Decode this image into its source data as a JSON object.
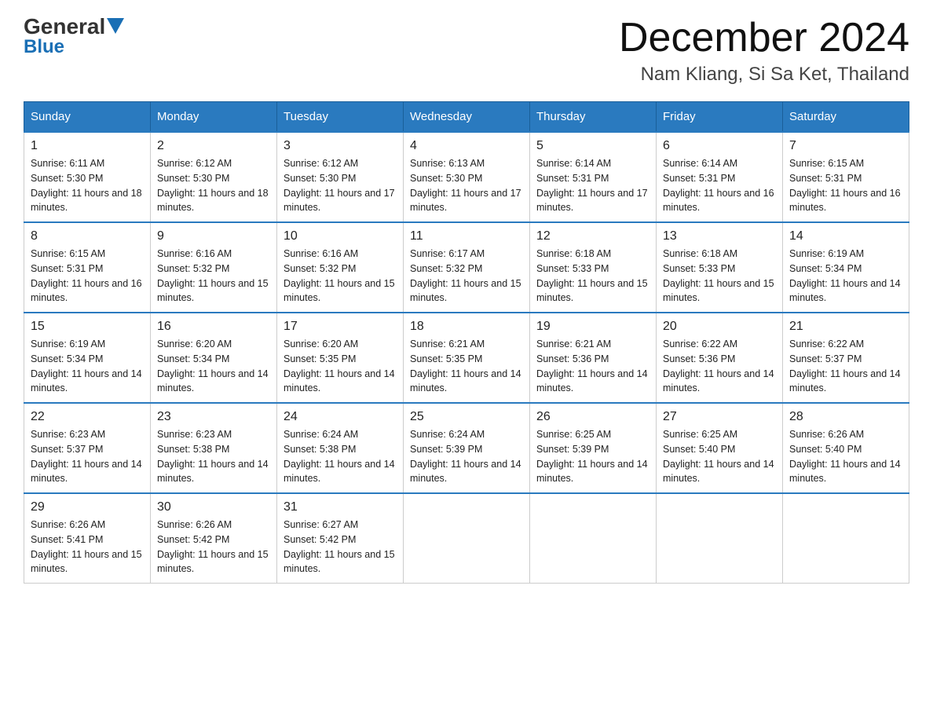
{
  "header": {
    "logo_general": "General",
    "logo_blue": "Blue",
    "month_title": "December 2024",
    "location": "Nam Kliang, Si Sa Ket, Thailand"
  },
  "weekdays": [
    "Sunday",
    "Monday",
    "Tuesday",
    "Wednesday",
    "Thursday",
    "Friday",
    "Saturday"
  ],
  "weeks": [
    [
      {
        "day": "1",
        "sunrise": "6:11 AM",
        "sunset": "5:30 PM",
        "daylight": "11 hours and 18 minutes."
      },
      {
        "day": "2",
        "sunrise": "6:12 AM",
        "sunset": "5:30 PM",
        "daylight": "11 hours and 18 minutes."
      },
      {
        "day": "3",
        "sunrise": "6:12 AM",
        "sunset": "5:30 PM",
        "daylight": "11 hours and 17 minutes."
      },
      {
        "day": "4",
        "sunrise": "6:13 AM",
        "sunset": "5:30 PM",
        "daylight": "11 hours and 17 minutes."
      },
      {
        "day": "5",
        "sunrise": "6:14 AM",
        "sunset": "5:31 PM",
        "daylight": "11 hours and 17 minutes."
      },
      {
        "day": "6",
        "sunrise": "6:14 AM",
        "sunset": "5:31 PM",
        "daylight": "11 hours and 16 minutes."
      },
      {
        "day": "7",
        "sunrise": "6:15 AM",
        "sunset": "5:31 PM",
        "daylight": "11 hours and 16 minutes."
      }
    ],
    [
      {
        "day": "8",
        "sunrise": "6:15 AM",
        "sunset": "5:31 PM",
        "daylight": "11 hours and 16 minutes."
      },
      {
        "day": "9",
        "sunrise": "6:16 AM",
        "sunset": "5:32 PM",
        "daylight": "11 hours and 15 minutes."
      },
      {
        "day": "10",
        "sunrise": "6:16 AM",
        "sunset": "5:32 PM",
        "daylight": "11 hours and 15 minutes."
      },
      {
        "day": "11",
        "sunrise": "6:17 AM",
        "sunset": "5:32 PM",
        "daylight": "11 hours and 15 minutes."
      },
      {
        "day": "12",
        "sunrise": "6:18 AM",
        "sunset": "5:33 PM",
        "daylight": "11 hours and 15 minutes."
      },
      {
        "day": "13",
        "sunrise": "6:18 AM",
        "sunset": "5:33 PM",
        "daylight": "11 hours and 15 minutes."
      },
      {
        "day": "14",
        "sunrise": "6:19 AM",
        "sunset": "5:34 PM",
        "daylight": "11 hours and 14 minutes."
      }
    ],
    [
      {
        "day": "15",
        "sunrise": "6:19 AM",
        "sunset": "5:34 PM",
        "daylight": "11 hours and 14 minutes."
      },
      {
        "day": "16",
        "sunrise": "6:20 AM",
        "sunset": "5:34 PM",
        "daylight": "11 hours and 14 minutes."
      },
      {
        "day": "17",
        "sunrise": "6:20 AM",
        "sunset": "5:35 PM",
        "daylight": "11 hours and 14 minutes."
      },
      {
        "day": "18",
        "sunrise": "6:21 AM",
        "sunset": "5:35 PM",
        "daylight": "11 hours and 14 minutes."
      },
      {
        "day": "19",
        "sunrise": "6:21 AM",
        "sunset": "5:36 PM",
        "daylight": "11 hours and 14 minutes."
      },
      {
        "day": "20",
        "sunrise": "6:22 AM",
        "sunset": "5:36 PM",
        "daylight": "11 hours and 14 minutes."
      },
      {
        "day": "21",
        "sunrise": "6:22 AM",
        "sunset": "5:37 PM",
        "daylight": "11 hours and 14 minutes."
      }
    ],
    [
      {
        "day": "22",
        "sunrise": "6:23 AM",
        "sunset": "5:37 PM",
        "daylight": "11 hours and 14 minutes."
      },
      {
        "day": "23",
        "sunrise": "6:23 AM",
        "sunset": "5:38 PM",
        "daylight": "11 hours and 14 minutes."
      },
      {
        "day": "24",
        "sunrise": "6:24 AM",
        "sunset": "5:38 PM",
        "daylight": "11 hours and 14 minutes."
      },
      {
        "day": "25",
        "sunrise": "6:24 AM",
        "sunset": "5:39 PM",
        "daylight": "11 hours and 14 minutes."
      },
      {
        "day": "26",
        "sunrise": "6:25 AM",
        "sunset": "5:39 PM",
        "daylight": "11 hours and 14 minutes."
      },
      {
        "day": "27",
        "sunrise": "6:25 AM",
        "sunset": "5:40 PM",
        "daylight": "11 hours and 14 minutes."
      },
      {
        "day": "28",
        "sunrise": "6:26 AM",
        "sunset": "5:40 PM",
        "daylight": "11 hours and 14 minutes."
      }
    ],
    [
      {
        "day": "29",
        "sunrise": "6:26 AM",
        "sunset": "5:41 PM",
        "daylight": "11 hours and 15 minutes."
      },
      {
        "day": "30",
        "sunrise": "6:26 AM",
        "sunset": "5:42 PM",
        "daylight": "11 hours and 15 minutes."
      },
      {
        "day": "31",
        "sunrise": "6:27 AM",
        "sunset": "5:42 PM",
        "daylight": "11 hours and 15 minutes."
      },
      null,
      null,
      null,
      null
    ]
  ]
}
